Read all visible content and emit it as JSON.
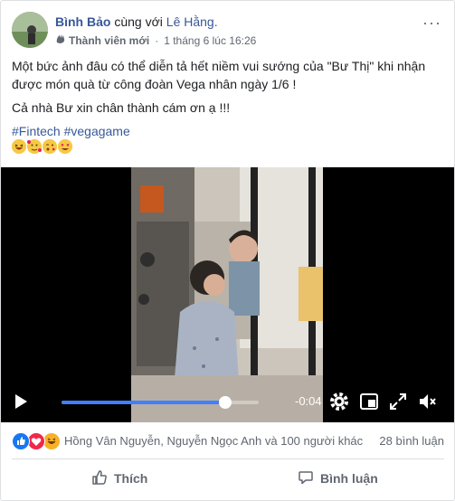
{
  "post": {
    "author": "Bình Bảo",
    "with_text": "cùng với",
    "tagged": "Lê Hằng.",
    "badge": "Thành viên mới",
    "time": "1 tháng 6 lúc 16:26",
    "line1": "Một bức ảnh đâu có thể diễn tả hết niềm vui sướng của \"Bư Thị\" khi nhận được món quà từ công đoàn Vega nhân ngày 1/6 !",
    "line2": "Cả nhà Bư xin chân thành cám ơn ạ !!!",
    "hashtags": "#Fintech #vegagame",
    "emojis": [
      "laughing-face",
      "hearts-face",
      "blowing-kiss-face",
      "heart-eyes-face"
    ]
  },
  "video": {
    "remaining": "-0:04",
    "progress": 0.83,
    "controls": [
      "play-icon",
      "settings-icon",
      "pip-icon",
      "fullscreen-icon",
      "volume-icon"
    ]
  },
  "reactions": {
    "types": [
      "like",
      "love",
      "haha"
    ],
    "names": "Hồng Vân Nguyễn, Nguyễn Ngọc Anh và 100 người khác",
    "comments": "28 bình luận"
  },
  "actions": {
    "like": "Thích",
    "comment": "Bình luận"
  },
  "colors": {
    "link": "#385898",
    "progress": "#4080ff",
    "like": "#1877f2",
    "love": "#f0284a",
    "haha": "#f7b125"
  }
}
